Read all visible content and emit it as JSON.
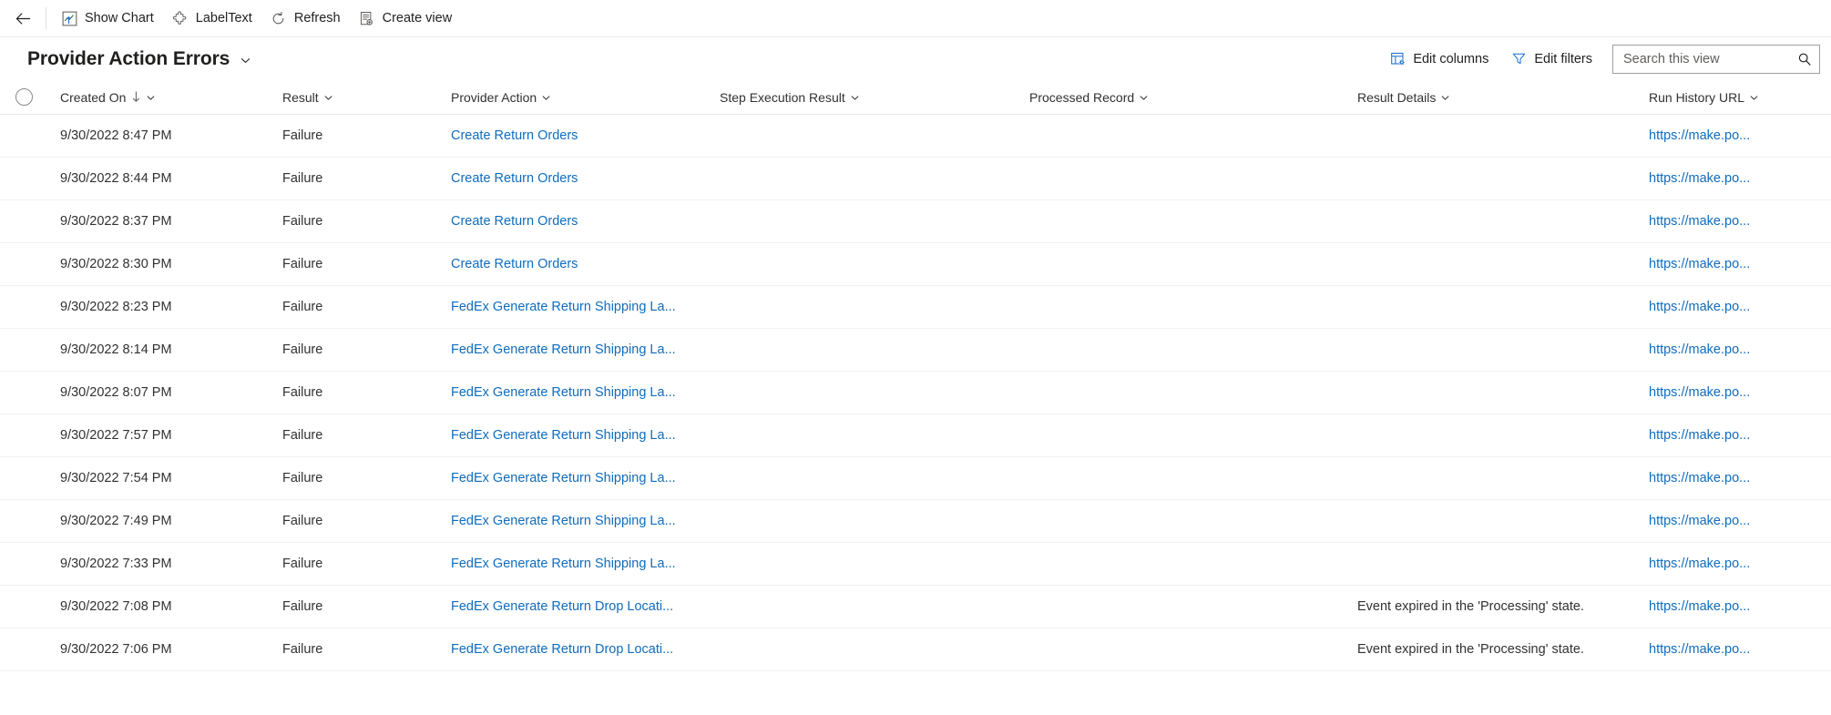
{
  "toolbar": {
    "back_label": "Back",
    "commands": [
      {
        "label": "Show Chart",
        "icon": "show-chart-icon"
      },
      {
        "label": "LabelText",
        "icon": "puzzle-piece-icon"
      },
      {
        "label": "Refresh",
        "icon": "refresh-icon"
      },
      {
        "label": "Create view",
        "icon": "create-view-icon"
      }
    ]
  },
  "header": {
    "title": "Provider Action Errors",
    "title_chevron": "chevron-down-icon",
    "edit_columns_label": "Edit columns",
    "edit_filters_label": "Edit filters",
    "search": {
      "placeholder": "Search this view",
      "value": "",
      "icon": "search-icon"
    }
  },
  "grid": {
    "select_all": "select-all-circle",
    "columns": [
      {
        "key": "created_on",
        "label": "Created On",
        "sort": "descending",
        "sort_glyph": "↓",
        "chevron": "chevron-down-icon"
      },
      {
        "key": "result",
        "label": "Result",
        "chevron": "chevron-down-icon"
      },
      {
        "key": "provider_action",
        "label": "Provider Action",
        "chevron": "chevron-down-icon"
      },
      {
        "key": "step_execution_result",
        "label": "Step Execution Result",
        "chevron": "chevron-down-icon"
      },
      {
        "key": "processed_record",
        "label": "Processed Record",
        "chevron": "chevron-down-icon"
      },
      {
        "key": "result_details",
        "label": "Result Details",
        "chevron": "chevron-down-icon"
      },
      {
        "key": "run_history_url",
        "label": "Run History URL",
        "chevron": "chevron-down-icon"
      }
    ],
    "rows": [
      {
        "created_on": "9/30/2022 8:47 PM",
        "result": "Failure",
        "provider_action": "Create Return Orders",
        "step_execution_result": "",
        "processed_record": "",
        "result_details": "",
        "run_history_url": "https://make.po..."
      },
      {
        "created_on": "9/30/2022 8:44 PM",
        "result": "Failure",
        "provider_action": "Create Return Orders",
        "step_execution_result": "",
        "processed_record": "",
        "result_details": "",
        "run_history_url": "https://make.po..."
      },
      {
        "created_on": "9/30/2022 8:37 PM",
        "result": "Failure",
        "provider_action": "Create Return Orders",
        "step_execution_result": "",
        "processed_record": "",
        "result_details": "",
        "run_history_url": "https://make.po..."
      },
      {
        "created_on": "9/30/2022 8:30 PM",
        "result": "Failure",
        "provider_action": "Create Return Orders",
        "step_execution_result": "",
        "processed_record": "",
        "result_details": "",
        "run_history_url": "https://make.po..."
      },
      {
        "created_on": "9/30/2022 8:23 PM",
        "result": "Failure",
        "provider_action": "FedEx Generate Return Shipping La...",
        "step_execution_result": "",
        "processed_record": "",
        "result_details": "",
        "run_history_url": "https://make.po..."
      },
      {
        "created_on": "9/30/2022 8:14 PM",
        "result": "Failure",
        "provider_action": "FedEx Generate Return Shipping La...",
        "step_execution_result": "",
        "processed_record": "",
        "result_details": "",
        "run_history_url": "https://make.po..."
      },
      {
        "created_on": "9/30/2022 8:07 PM",
        "result": "Failure",
        "provider_action": "FedEx Generate Return Shipping La...",
        "step_execution_result": "",
        "processed_record": "",
        "result_details": "",
        "run_history_url": "https://make.po..."
      },
      {
        "created_on": "9/30/2022 7:57 PM",
        "result": "Failure",
        "provider_action": "FedEx Generate Return Shipping La...",
        "step_execution_result": "",
        "processed_record": "",
        "result_details": "",
        "run_history_url": "https://make.po..."
      },
      {
        "created_on": "9/30/2022 7:54 PM",
        "result": "Failure",
        "provider_action": "FedEx Generate Return Shipping La...",
        "step_execution_result": "",
        "processed_record": "",
        "result_details": "",
        "run_history_url": "https://make.po..."
      },
      {
        "created_on": "9/30/2022 7:49 PM",
        "result": "Failure",
        "provider_action": "FedEx Generate Return Shipping La...",
        "step_execution_result": "",
        "processed_record": "",
        "result_details": "",
        "run_history_url": "https://make.po..."
      },
      {
        "created_on": "9/30/2022 7:33 PM",
        "result": "Failure",
        "provider_action": "FedEx Generate Return Shipping La...",
        "step_execution_result": "",
        "processed_record": "",
        "result_details": "",
        "run_history_url": "https://make.po..."
      },
      {
        "created_on": "9/30/2022 7:08 PM",
        "result": "Failure",
        "provider_action": "FedEx Generate Return Drop Locati...",
        "step_execution_result": "",
        "processed_record": "",
        "result_details": "Event expired in the 'Processing' state.",
        "run_history_url": "https://make.po..."
      },
      {
        "created_on": "9/30/2022 7:06 PM",
        "result": "Failure",
        "provider_action": "FedEx Generate Return Drop Locati...",
        "step_execution_result": "",
        "processed_record": "",
        "result_details": "Event expired in the 'Processing' state.",
        "run_history_url": "https://make.po..."
      }
    ]
  },
  "colors": {
    "link": "#0f6cbd",
    "icon_accent": "#0f6cbd",
    "text": "#323130",
    "border": "#edebe9"
  }
}
